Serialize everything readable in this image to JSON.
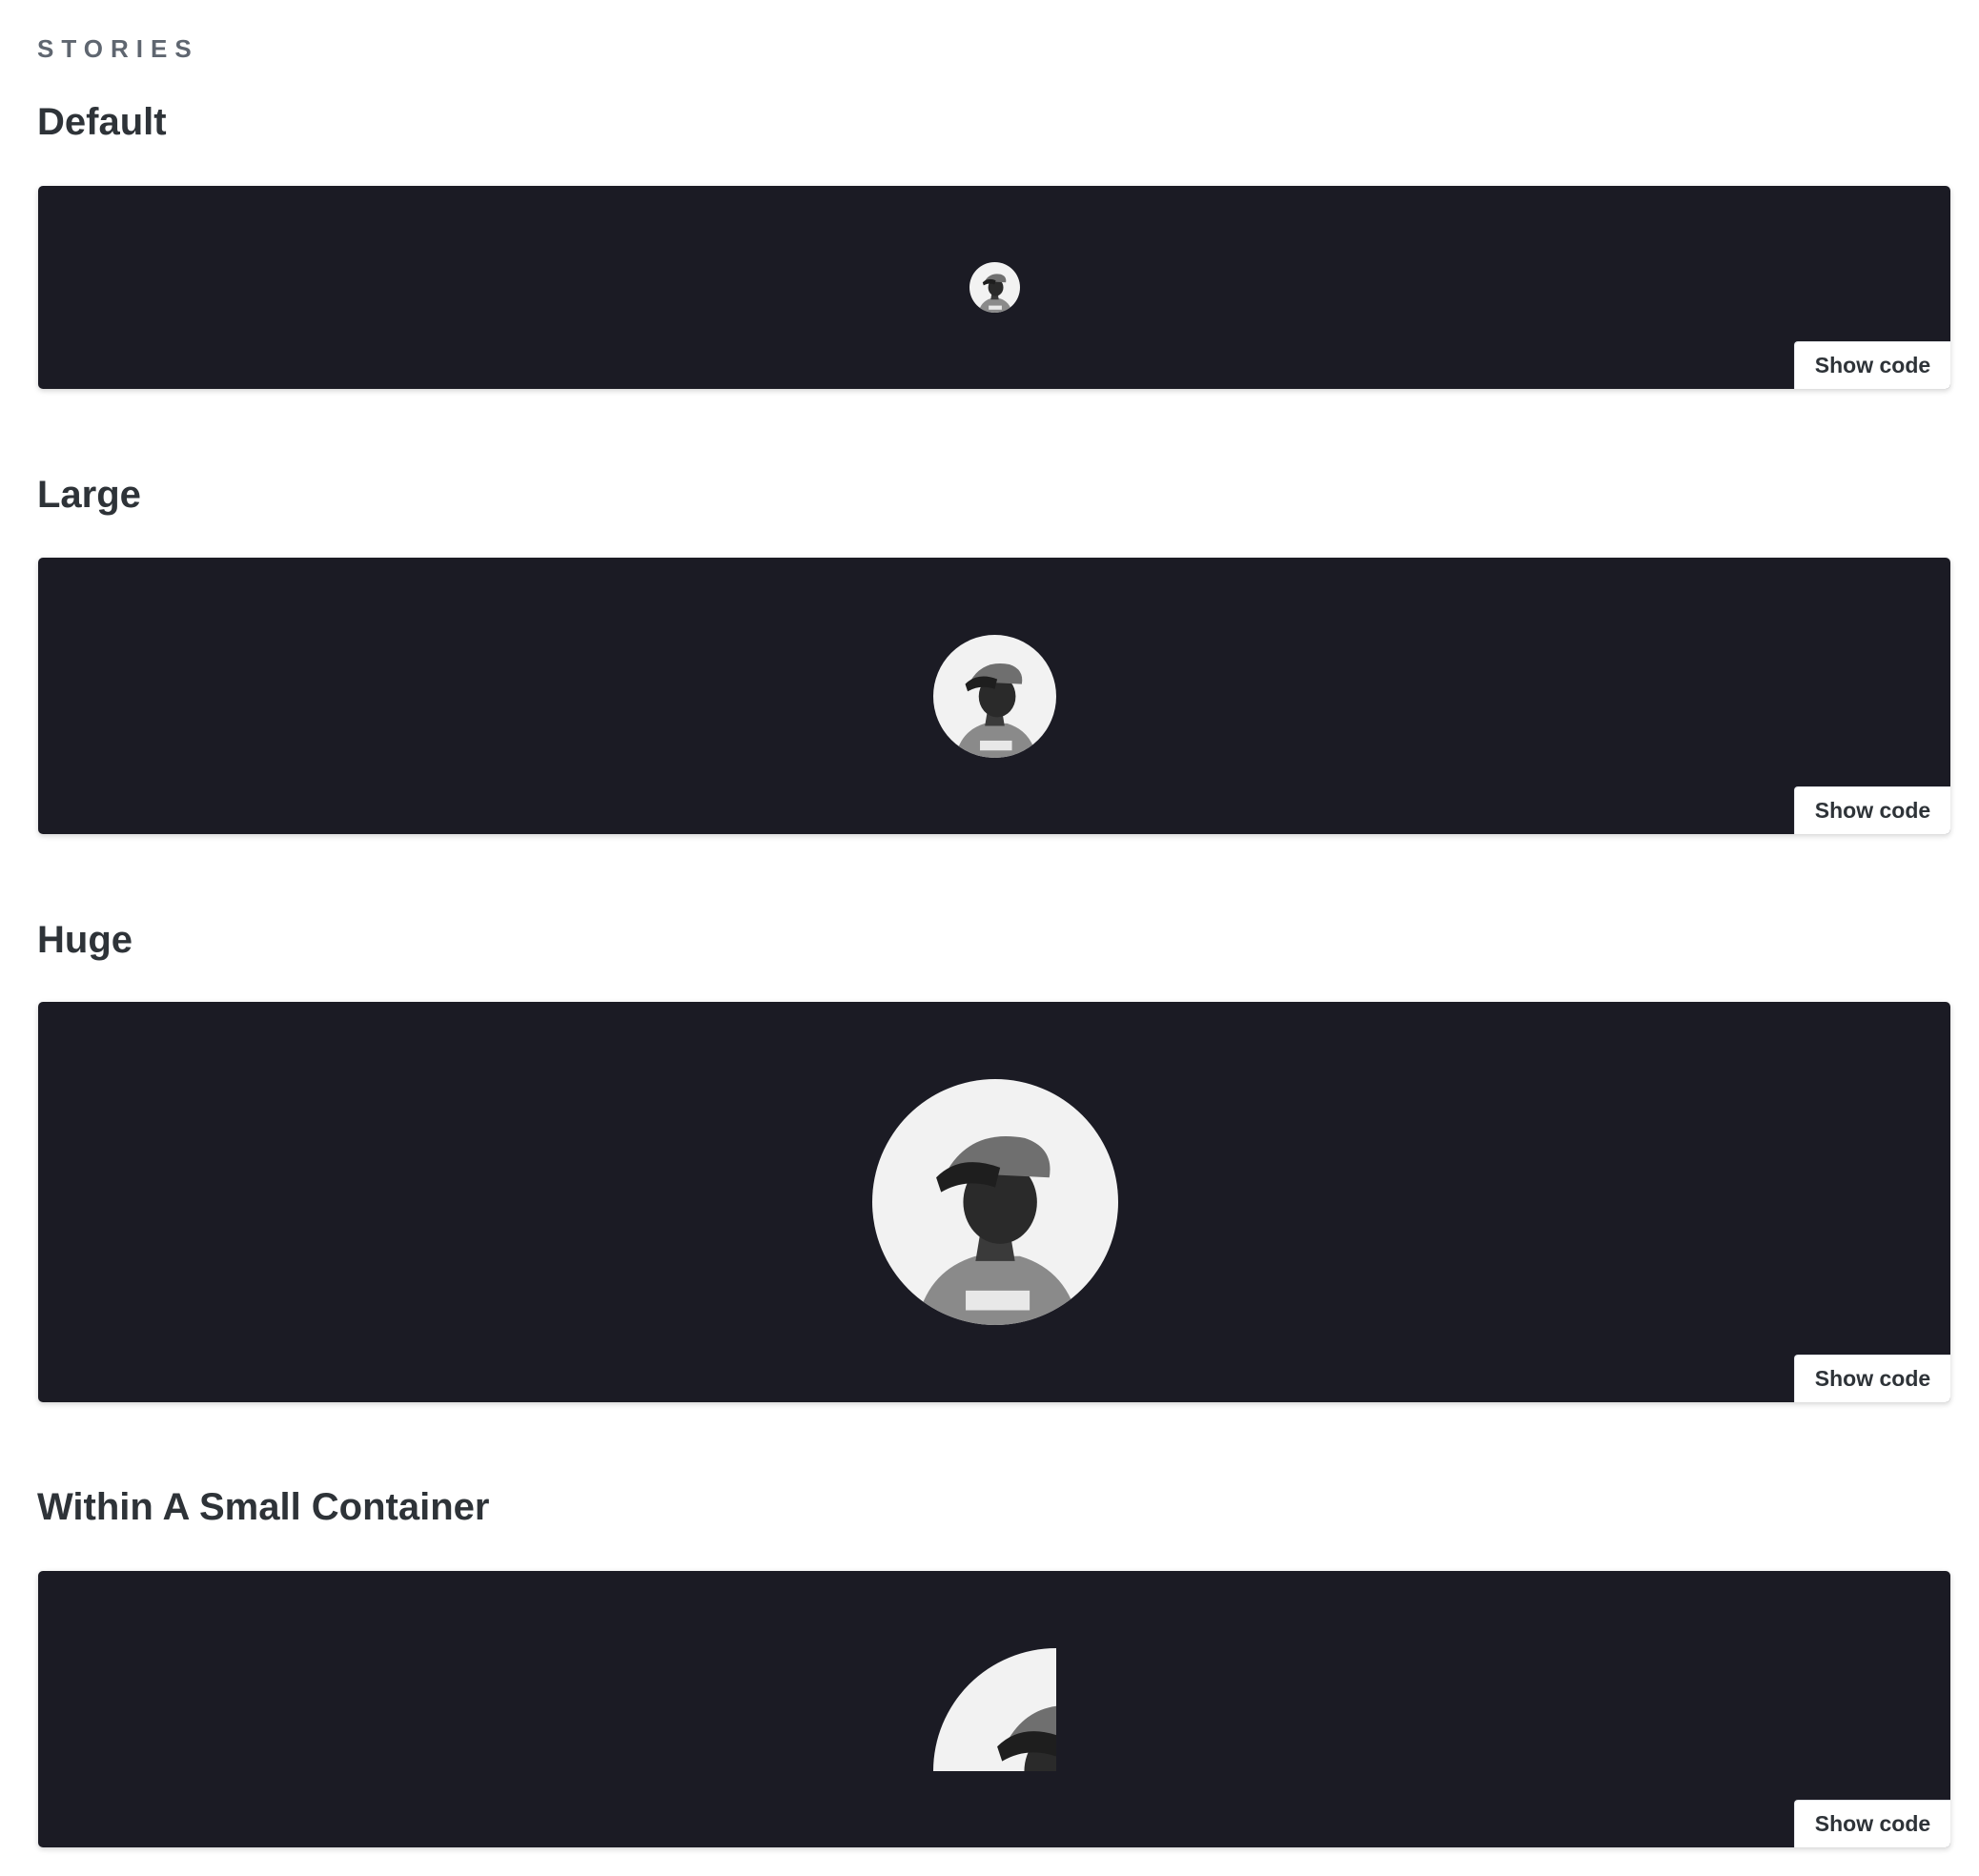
{
  "section_label": "STORIES",
  "stories": [
    {
      "title": "Default",
      "show_code_label": "Show code",
      "avatar_size": "default"
    },
    {
      "title": "Large",
      "show_code_label": "Show code",
      "avatar_size": "large"
    },
    {
      "title": "Huge",
      "show_code_label": "Show code",
      "avatar_size": "huge"
    },
    {
      "title": "Within A Small Container",
      "show_code_label": "Show code",
      "avatar_size": "large, clipped by small container"
    }
  ],
  "colors": {
    "preview_background": "#1b1b24",
    "heading_text": "#2e3338",
    "label_text": "#5f6670"
  },
  "icons": {
    "avatar": "user-avatar-photo"
  }
}
